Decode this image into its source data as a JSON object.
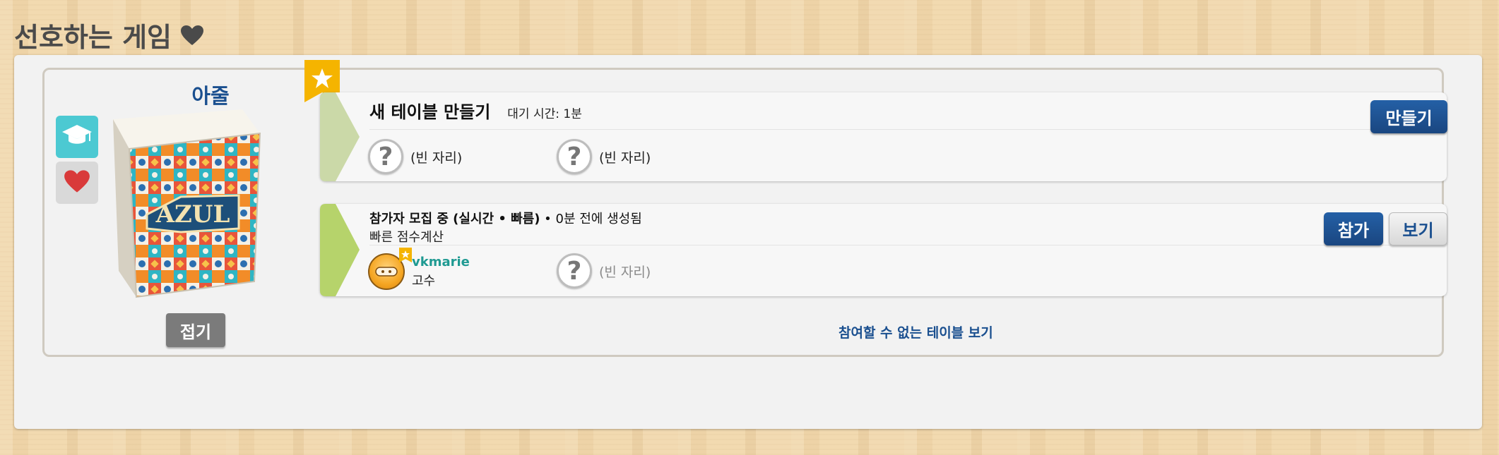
{
  "section": {
    "title": "선호하는 게임"
  },
  "game": {
    "name": "아줄",
    "boxart_text": "AZUL",
    "fold_label": "접기"
  },
  "new_table": {
    "title": "새 테이블 만들기",
    "wait_text": "대기 시간: 1분",
    "create_label": "만들기",
    "seats": [
      "(빈 자리)",
      "(빈 자리)"
    ]
  },
  "open_table": {
    "status": "참가자 모집 중 (실시간 • 빠름)",
    "created": " • 0분 전에 생성됨",
    "option": "빠른 점수계산",
    "join_label": "참가",
    "view_label": "보기",
    "player": {
      "name": "vkmarie",
      "rank": "고수"
    },
    "empty_seat": "(빈 자리)"
  },
  "more_link": "참여할 수 없는 테이블 보기",
  "colors": {
    "accent_blue": "#1e4f8c",
    "player_teal": "#1f9a92",
    "chevron_green": "#b6d36b",
    "chevron_light": "#cbd9a8",
    "ribbon_gold": "#f5b400"
  }
}
